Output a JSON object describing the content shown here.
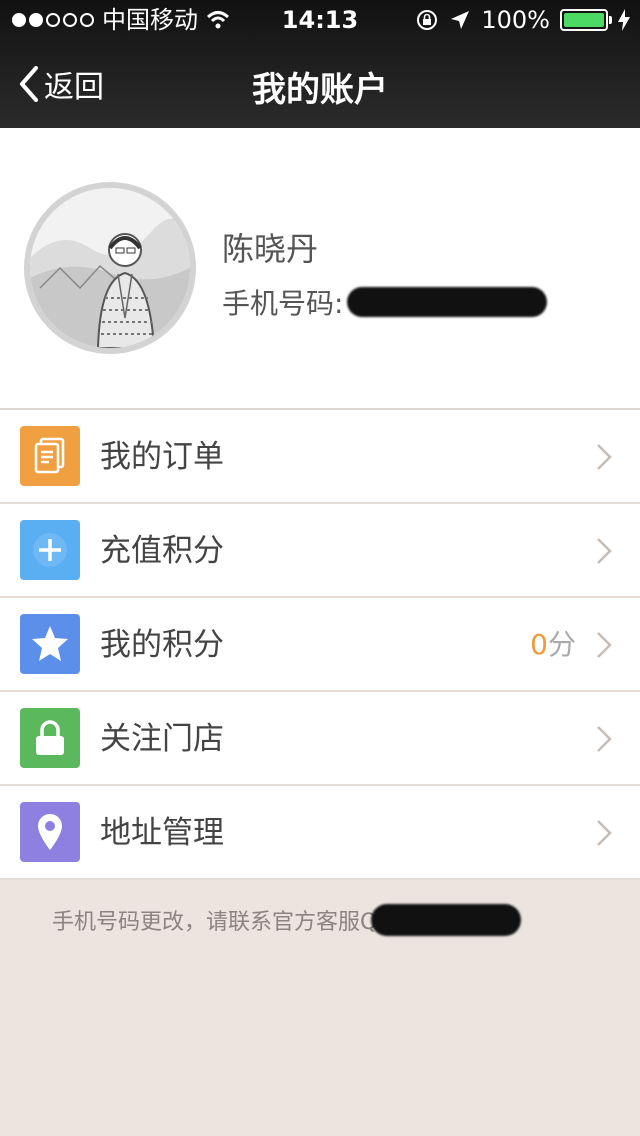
{
  "status_bar": {
    "carrier": "中国移动",
    "time": "14:13",
    "battery": "100%"
  },
  "nav": {
    "back_label": "返回",
    "title": "我的账户"
  },
  "profile": {
    "name": "陈晓丹",
    "phone_label": "手机号码:"
  },
  "menu": {
    "items": [
      {
        "label": "我的订单",
        "icon": "document-icon",
        "color": "#f0a040"
      },
      {
        "label": "充值积分",
        "icon": "plus-icon",
        "color": "#5aaef2"
      },
      {
        "label": "我的积分",
        "icon": "star-icon",
        "color": "#5b8fea",
        "points_value": "0",
        "points_unit": "分"
      },
      {
        "label": "关注门店",
        "icon": "lock-icon",
        "color": "#5cb85c"
      },
      {
        "label": "地址管理",
        "icon": "location-pin-icon",
        "color": "#8e80e0"
      }
    ]
  },
  "footer": {
    "note": "手机号码更改，请联系官方客服Q"
  }
}
